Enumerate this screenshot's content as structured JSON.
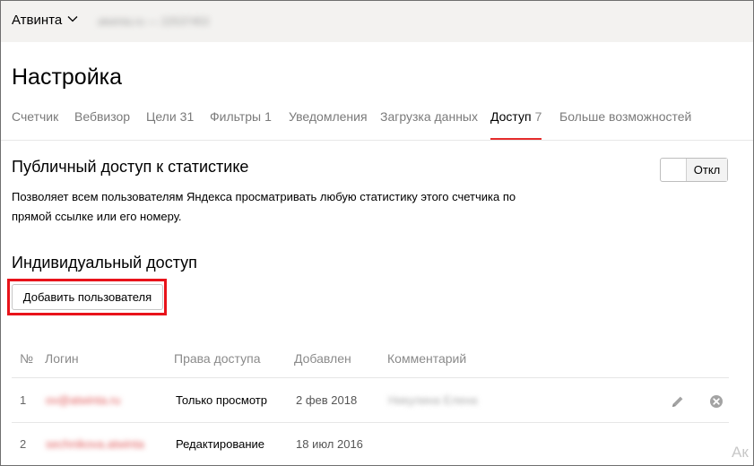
{
  "header": {
    "org_name": "Атвинта",
    "counter_info": "atwinta.ru — 22537453"
  },
  "page": {
    "title": "Настройка"
  },
  "tabs": [
    {
      "label": "Счетчик",
      "count": ""
    },
    {
      "label": "Вебвизор",
      "count": ""
    },
    {
      "label": "Цели",
      "count": "31"
    },
    {
      "label": "Фильтры",
      "count": "1"
    },
    {
      "label": "Уведомления",
      "count": ""
    },
    {
      "label": "Загрузка данных",
      "count": ""
    },
    {
      "label": "Доступ",
      "count": "7",
      "active": true
    },
    {
      "label": "Больше возможностей",
      "count": ""
    }
  ],
  "public_access": {
    "title": "Публичный доступ к статистике",
    "description": "Позволяет всем пользователям Яндекса просматривать любую статистику этого счетчика по прямой ссылке или его номеру.",
    "toggle_label": "Откл",
    "toggle_on": false
  },
  "individual_access": {
    "title": "Индивидуальный доступ",
    "add_button_label": "Добавить пользователя"
  },
  "table": {
    "headers": {
      "number": "№",
      "login": "Логин",
      "rights": "Права доступа",
      "added": "Добавлен",
      "comment": "Комментарий"
    },
    "rows": [
      {
        "number": "1",
        "login": "ov@atwinta.ru",
        "rights": "Только просмотр",
        "added": "2 фев 2018",
        "comment": "Никулина Елена"
      },
      {
        "number": "2",
        "login": "sechnikova.atwinta",
        "rights": "Редактирование",
        "added": "18 июл 2016",
        "comment": ""
      }
    ]
  },
  "partial_text": "Ак",
  "icons": {
    "org_chevron": "chevron-down-icon",
    "edit": "pencil-icon",
    "remove": "close-circle-icon"
  },
  "colors": {
    "accent_red": "#e52c2c",
    "highlight_red": "#e8131a",
    "topbar_bg": "#f3f2f0",
    "muted_text": "#7a7a7a"
  }
}
